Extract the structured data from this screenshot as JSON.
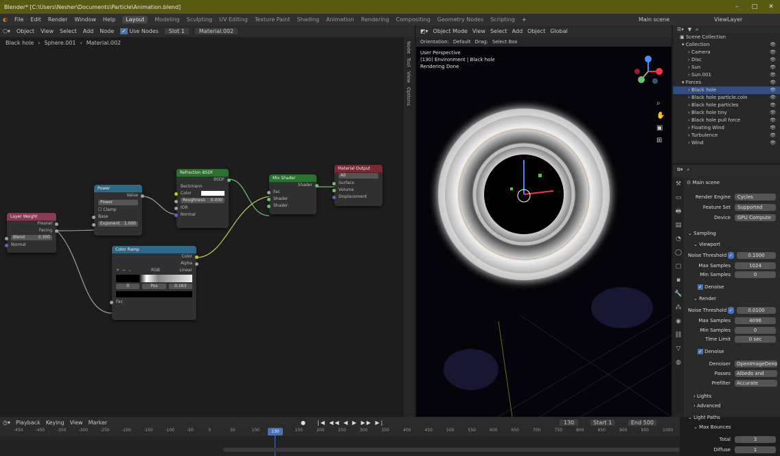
{
  "app": {
    "title": "Blender* [C:\\Users\\Nesher\\Documents\\Particle\\Animation.blend]"
  },
  "menubar": {
    "menus": [
      "File",
      "Edit",
      "Render",
      "Window",
      "Help"
    ],
    "workspaces": [
      "Layout",
      "Modeling",
      "Sculpting",
      "UV Editing",
      "Texture Paint",
      "Shading",
      "Animation",
      "Rendering",
      "Compositing",
      "Geometry Nodes",
      "Scripting"
    ],
    "active_workspace": "Layout",
    "scene": "Main scene",
    "view_layer": "ViewLayer"
  },
  "node_editor": {
    "editor_type": "Object",
    "menus": [
      "View",
      "Select",
      "Add",
      "Node"
    ],
    "use_nodes_label": "Use Nodes",
    "slot": "Slot 1",
    "material": "Material.002",
    "breadcrumb": [
      "Black hole",
      "Sphere.001",
      "Material.002"
    ],
    "nodes": {
      "layer_weight": {
        "title": "Layer Weight",
        "out1": "Fresnel",
        "out2": "Facing",
        "blend_label": "Blend",
        "blend_value": "0.300",
        "in_normal": "Normal"
      },
      "power": {
        "title": "Power",
        "out": "Value",
        "mode": "Power",
        "clamp": "Clamp",
        "in_base": "Base",
        "exponent_label": "Exponent",
        "exponent_value": "1.000"
      },
      "refraction": {
        "title": "Refraction BSDF",
        "out": "BSDF",
        "dist": "Beckmann",
        "color": "Color",
        "roughness": "Roughness",
        "roughness_val": "0.000",
        "ior": "IOR",
        "normal": "Normal"
      },
      "mix": {
        "title": "Mix Shader",
        "out": "Shader",
        "fac": "Fac",
        "s1": "Shader",
        "s2": "Shader"
      },
      "output": {
        "title": "Material Output",
        "target": "All",
        "surface": "Surface",
        "volume": "Volume",
        "disp": "Displacement"
      },
      "ramp": {
        "title": "Color Ramp",
        "out1": "Color",
        "out2": "Alpha",
        "mode": "RGB",
        "interp": "Linear",
        "pos_a": "0",
        "pos_lbl": "Pos",
        "pos_v": "0.163",
        "in_fac": "Fac"
      }
    }
  },
  "viewport": {
    "mode": "Object Mode",
    "menus": [
      "View",
      "Select",
      "Add",
      "Object"
    ],
    "orientation_label": "Orientation:",
    "orientation": "Default",
    "drag_label": "Drag:",
    "drag": "Select Box",
    "global": "Global",
    "info": [
      "User Perspective",
      "(130) Environment | Black hole",
      "Rendering Done"
    ]
  },
  "outliner": {
    "title": "Scene Collection",
    "items": [
      {
        "name": "Collection",
        "indent": 1
      },
      {
        "name": "Camera",
        "indent": 2
      },
      {
        "name": "Disc",
        "indent": 2
      },
      {
        "name": "Sun",
        "indent": 2
      },
      {
        "name": "Sun.001",
        "indent": 2
      },
      {
        "name": "Forces",
        "indent": 1
      },
      {
        "name": "Black hole",
        "indent": 2,
        "selected": true
      },
      {
        "name": "Black hole particle.coin",
        "indent": 2
      },
      {
        "name": "Black hole particles",
        "indent": 2
      },
      {
        "name": "Black hole tiny",
        "indent": 2
      },
      {
        "name": "Black hole pull force",
        "indent": 2
      },
      {
        "name": "Floating Wind",
        "indent": 2
      },
      {
        "name": "Turbulence",
        "indent": 2
      },
      {
        "name": "Wind",
        "indent": 2
      }
    ]
  },
  "properties": {
    "scene_name": "Main scene",
    "render_engine_label": "Render Engine",
    "render_engine": "Cycles",
    "feature_set_label": "Feature Set",
    "feature_set": "Supported",
    "device_label": "Device",
    "device": "GPU Compute",
    "sampling": "Sampling",
    "viewport": "Viewport",
    "noise_threshold_label": "Noise Threshold",
    "vp_noise": "0.1000",
    "max_samples_label": "Max Samples",
    "vp_max": "1024",
    "min_samples_label": "Min Samples",
    "vp_min": "0",
    "denoise": "Denoise",
    "render": "Render",
    "r_noise": "0.0100",
    "r_max": "4096",
    "r_min": "0",
    "time_limit_label": "Time Limit",
    "r_time": "0 sec",
    "denoiser_label": "Denoiser",
    "denoiser": "OpenImageDenoise",
    "passes_label": "Passes",
    "passes": "Albedo and Normal",
    "prefilter_label": "Prefilter",
    "prefilter": "Accurate",
    "lights": "Lights",
    "advanced": "Advanced",
    "light_paths": "Light Paths",
    "max_bounces": "Max Bounces",
    "total_label": "Total",
    "total": "3",
    "diffuse_label": "Diffuse",
    "diffuse": "1"
  },
  "timeline": {
    "menus": [
      "Playback",
      "Keying",
      "View",
      "Marker"
    ],
    "current_frame": "130",
    "start_label": "Start",
    "start": "1",
    "end_label": "End",
    "end": "500",
    "ticks": [
      "-450",
      "-400",
      "-350",
      "-300",
      "-250",
      "-200",
      "-150",
      "-100",
      "-50",
      "0",
      "50",
      "100",
      "130",
      "150",
      "200",
      "250",
      "300",
      "350",
      "400",
      "450",
      "500",
      "550",
      "600",
      "650",
      "700",
      "750",
      "800",
      "850",
      "900",
      "950",
      "1000"
    ]
  }
}
